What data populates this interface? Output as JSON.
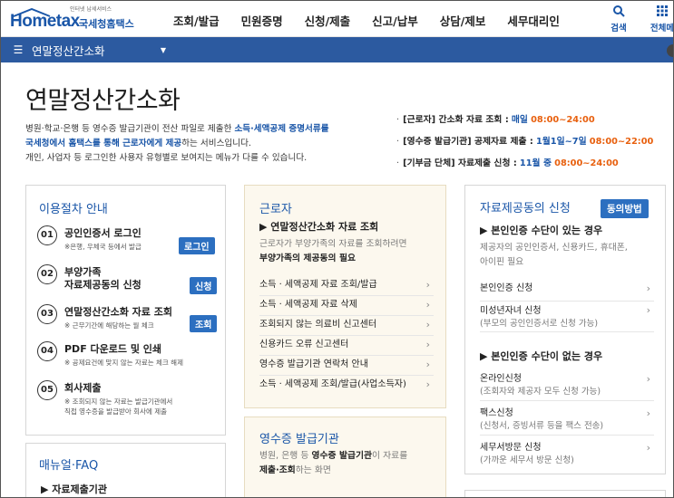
{
  "header": {
    "logo_tagline": "인터넷 납세서비스",
    "logo_brand": "Hometax",
    "logo_name": "국세청홈택스",
    "menu": [
      "조회/발급",
      "민원증명",
      "신청/제출",
      "신고/납부",
      "상담/제보",
      "세무대리인"
    ],
    "util": [
      {
        "label": "검색",
        "icon": "search-icon"
      },
      {
        "label": "전체메",
        "icon": "grid-icon"
      }
    ]
  },
  "navbar": {
    "current": "연말정산간소화"
  },
  "page": {
    "title": "연말정산간소화",
    "intro": {
      "line1_pre": "병원·학교·은행 등 영수증 발급기관이 전산 파일로 제출한 ",
      "line1_hl": "소득·세액공제 증명서류를",
      "line2_hl": "국세청에서 홈택스를 통해 근로자에게 제공",
      "line2_post": "하는 서비스입니다.",
      "line3": "개인, 사업자 등 로그인한 사용자 유형별로 보여지는 메뉴가 다를 수 있습니다."
    },
    "schedule": [
      {
        "label": "[근로자] 간소화 자료 조회 :",
        "hl_blue": "매일",
        "hl_or": "08:00~24:00"
      },
      {
        "label": "[영수증 발급기관] 공제자료 제출 :",
        "hl_blue": "1월1일~7일",
        "hl_or": "08:00~22:00"
      },
      {
        "label": "[기부금 단체] 자료제출 신청 :",
        "hl_blue": "11월 중",
        "hl_or": "08:00~24:00"
      }
    ]
  },
  "procedure": {
    "title": "이용절차 안내",
    "steps": [
      {
        "num": "01",
        "title": "공인인증서 로그인",
        "desc": [
          "※은행, 우체국 등에서 발급"
        ],
        "button": "로그인"
      },
      {
        "num": "02",
        "title": "부양가족",
        "title2": "자료제공동의 신청",
        "desc": [],
        "button": "신청"
      },
      {
        "num": "03",
        "title": "연말정산간소화 자료 조회",
        "desc": [
          "※ 근무기간에 해당하는 월 체크"
        ],
        "button": "조회"
      },
      {
        "num": "04",
        "title": "PDF 다운로드 및 인쇄",
        "desc": [
          "※ 공제요건에 맞지 않는 자료는 체크 해제"
        ]
      },
      {
        "num": "05",
        "title": "회사제출",
        "desc": [
          "※ 조회되지 않는 자료는 발급기관에서",
          "직접 영수증을 발급받아 회사에 제출"
        ]
      }
    ]
  },
  "manual": {
    "title": "매뉴얼·FAQ",
    "item": "▶ 자료제출기관"
  },
  "worker": {
    "title": "근로자",
    "sub_head": "▶ 연말정산간소화 자료 조회",
    "desc1": "근로자가 부양가족의 자료를 조회하려면",
    "desc2": "부양가족의 제공동의 필요",
    "links": [
      "소득 · 세액공제 자료 조회/발급",
      "소득 · 세액공제 자료 삭제",
      "조회되지 않는 의료비 신고센터",
      "신용카드 오류 신고센터",
      "영수증 발급기관 연락처 안내",
      "소득 · 세액공제 조회/발급(사업소득자)"
    ]
  },
  "issuer": {
    "title": "영수증 발급기관",
    "desc1_pre": "병원, 은행 등 ",
    "desc1_hl": "영수증 발급기관",
    "desc1_post": "이 자료를",
    "desc2_hl": "제출·조회",
    "desc2_post": "하는 화면"
  },
  "consent": {
    "title": "자료제공동의 신청",
    "method_button": "동의방법",
    "group1_head": "▶ 본인인증 수단이 있는 경우",
    "group1_desc1": "제공자의 공인인증서, 신용카드, 휴대폰,",
    "group1_desc2": "아이핀 필요",
    "group1_links": [
      {
        "label": "본인인증 신청",
        "sub": ""
      },
      {
        "label": "미성년자녀 신청",
        "sub": "(부모의 공인인증서로 신청 가능)"
      }
    ],
    "group2_head": "▶ 본인인증 수단이 없는 경우",
    "group2_links": [
      {
        "label": "온라인신청",
        "sub": "(조회자와 제공자 모두 신청 가능)"
      },
      {
        "label": "팩스신청",
        "sub": "(신청서, 증빙서류 등을 팩스 전송)"
      },
      {
        "label": "세무서방문 신청",
        "sub": "(가까운 세무서 방문 신청)"
      }
    ]
  },
  "colors": {
    "primary": "#1a56a8",
    "navbar": "#2c5aa0",
    "button": "#2c6fc0",
    "orange": "#e8600e",
    "beige": "#fcf8ee"
  }
}
